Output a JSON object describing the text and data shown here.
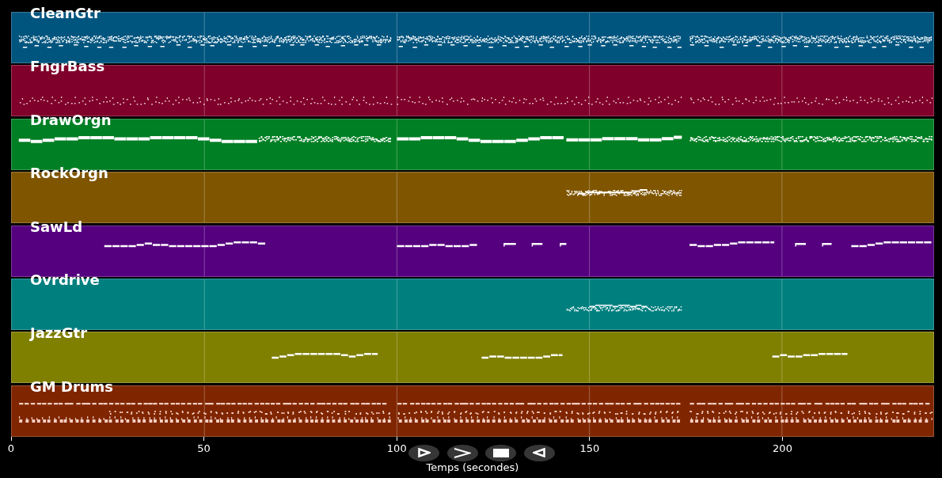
{
  "tracks": [
    {
      "name": "CleanGtr",
      "color": "#00557f"
    },
    {
      "name": "FngrBass",
      "color": "#7f002a"
    },
    {
      "name": "DrawOrgn",
      "color": "#007f24"
    },
    {
      "name": "RockOrgn",
      "color": "#7f5500"
    },
    {
      "name": "SawLd",
      "color": "#55007f"
    },
    {
      "name": "Ovrdrive",
      "color": "#007f7f"
    },
    {
      "name": "JazzGtr",
      "color": "#7f7f00"
    },
    {
      "name": "GM Drums",
      "color": "#7f2600"
    }
  ],
  "x_axis": {
    "ticks": [
      "0",
      "50",
      "100",
      "150",
      "200"
    ],
    "title": "Temps (secondes)"
  },
  "playback_buttons": [
    {
      "kind": "play"
    },
    {
      "kind": "forward"
    },
    {
      "kind": "stop"
    },
    {
      "kind": "back"
    }
  ]
}
